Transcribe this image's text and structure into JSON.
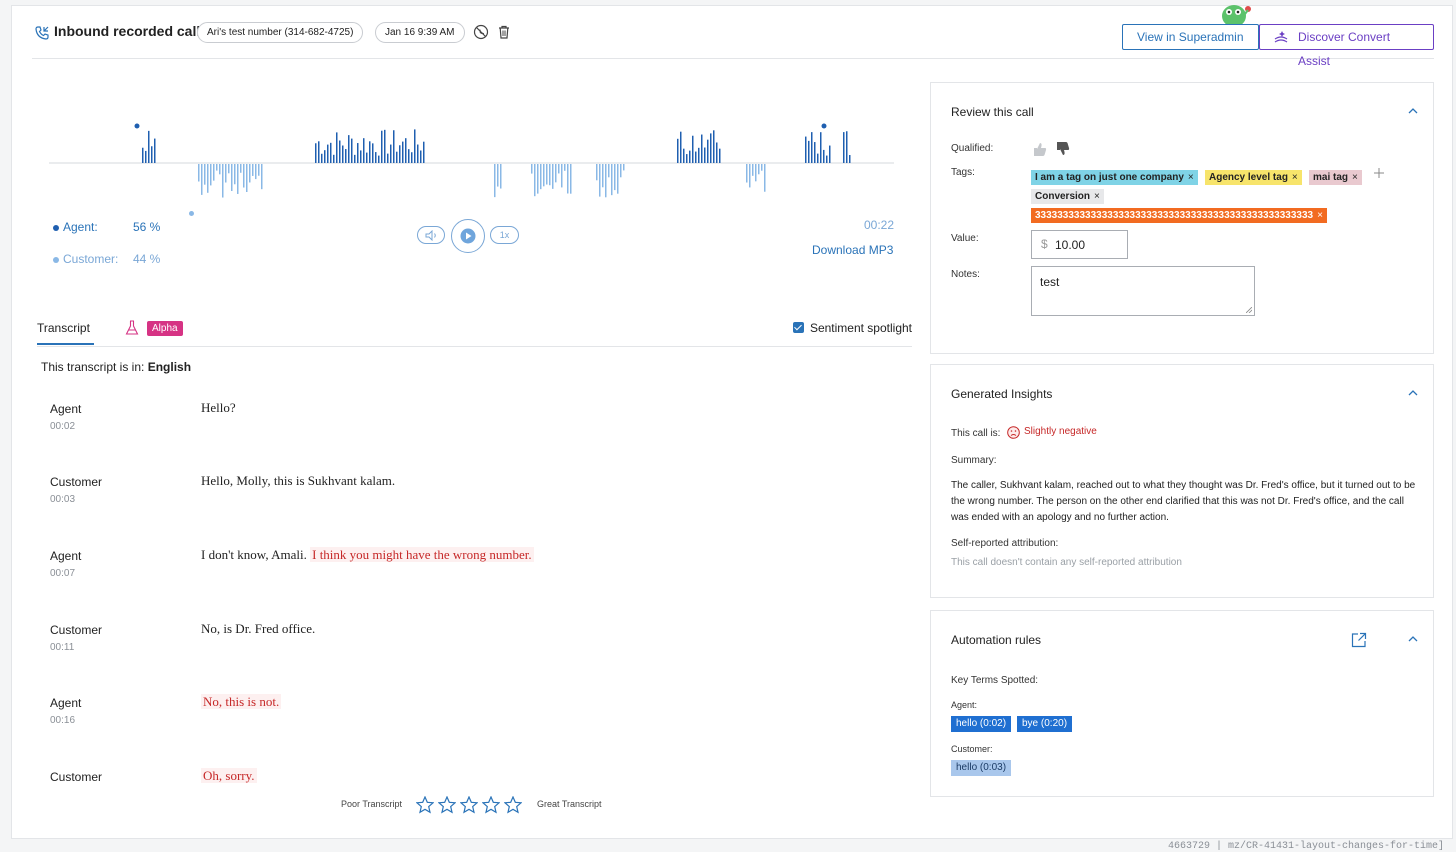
{
  "header": {
    "title": "Inbound recorded call",
    "number_pill": "Ari's test number (314-682-4725)",
    "date_pill": "Jan 16  9:39 AM",
    "view_superadmin": "View in Superadmin",
    "discover_convert_assist": "Discover Convert Assist"
  },
  "player": {
    "agent_label": "Agent:",
    "agent_pct": "56 %",
    "customer_label": "Customer:",
    "customer_pct": "44 %",
    "speed": "1x",
    "duration": "00:22",
    "download": "Download MP3",
    "colors": {
      "agent": "#1f5fb0",
      "customer": "#8ab8e6"
    }
  },
  "transcript": {
    "tab_label": "Transcript",
    "alpha_badge": "Alpha",
    "sentiment_label": "Sentiment spotlight",
    "lang_prefix": "This transcript is in:",
    "lang_value": "English",
    "rows": [
      {
        "speaker": "Agent",
        "time": "00:02",
        "text": "Hello?",
        "neg": ""
      },
      {
        "speaker": "Customer",
        "time": "00:03",
        "text": "Hello, Molly, this is Sukhvant kalam.",
        "neg": ""
      },
      {
        "speaker": "Agent",
        "time": "00:07",
        "text": "I don't know, Amali.",
        "neg": "I think you might have the wrong number."
      },
      {
        "speaker": "Customer",
        "time": "00:11",
        "text": "No, is Dr. Fred office.",
        "neg": ""
      },
      {
        "speaker": "Agent",
        "time": "00:16",
        "text": "",
        "neg": "No, this is not."
      },
      {
        "speaker": "Customer",
        "time": "",
        "text": "",
        "neg": "Oh, sorry."
      }
    ],
    "rating_poor": "Poor Transcript",
    "rating_great": "Great Transcript"
  },
  "review": {
    "title": "Review this call",
    "qualified_label": "Qualified:",
    "tags_label": "Tags:",
    "tags": [
      {
        "label": "I am a tag on just one company",
        "color": "#7fd3e6"
      },
      {
        "label": "Agency level tag",
        "color": "#f7e46b"
      },
      {
        "label": "mai tag",
        "color": "#e9c9cf"
      },
      {
        "label": "Conversion",
        "color": "#e7e8ea"
      },
      {
        "label": "33333333333333333333333333333333333333333333333333",
        "color": "#f26b21"
      }
    ],
    "value_label": "Value:",
    "currency": "$",
    "value": "10.00",
    "notes_label": "Notes:",
    "notes": "test"
  },
  "insights": {
    "title": "Generated Insights",
    "call_is_label": "This call is:",
    "sentiment": "Slightly negative",
    "summary_label": "Summary:",
    "summary": "The caller, Sukhvant kalam, reached out to what they thought was Dr. Fred's office, but it turned out to be the wrong number. The person on the other end clarified that this was not Dr. Fred's office, and the call was ended with an apology and no further action.",
    "attribution_label": "Self-reported attribution:",
    "attribution": "This call doesn't contain any self-reported attribution"
  },
  "automation": {
    "title": "Automation rules",
    "key_terms_label": "Key Terms Spotted:",
    "agent_label": "Agent:",
    "agent_terms": [
      "hello (0:02)",
      "bye (0:20)"
    ],
    "customer_label": "Customer:",
    "customer_terms": [
      "hello (0:03)"
    ]
  },
  "footer": {
    "build": "4663729 | mz/CR-41431-layout-changes-for-time]"
  }
}
